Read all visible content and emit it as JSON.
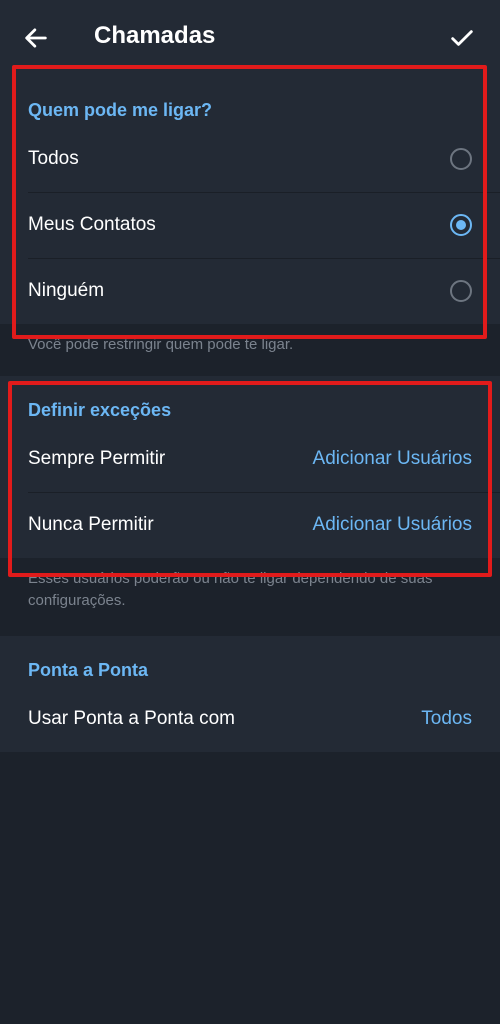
{
  "appbar": {
    "title": "Chamadas",
    "back_icon": "arrow-left-icon",
    "confirm_icon": "check-icon"
  },
  "who_can_call": {
    "header": "Quem pode me ligar?",
    "options": [
      {
        "label": "Todos",
        "selected": false
      },
      {
        "label": "Meus Contatos",
        "selected": true
      },
      {
        "label": "Ninguém",
        "selected": false
      }
    ],
    "note": "Você pode restringir quem pode te ligar."
  },
  "exceptions": {
    "header": "Definir exceções",
    "rows": [
      {
        "label": "Sempre Permitir",
        "value": "Adicionar Usuários"
      },
      {
        "label": "Nunca Permitir",
        "value": "Adicionar Usuários"
      }
    ],
    "note": "Esses usuários poderão ou não te ligar dependendo de suas configurações."
  },
  "p2p": {
    "header": "Ponta a Ponta",
    "row": {
      "label": "Usar Ponta a Ponta com",
      "value": "Todos"
    }
  },
  "colors": {
    "accent": "#6cb7f4",
    "highlight": "#e11b1b",
    "background": "#1c222b",
    "surface": "#232a35"
  }
}
